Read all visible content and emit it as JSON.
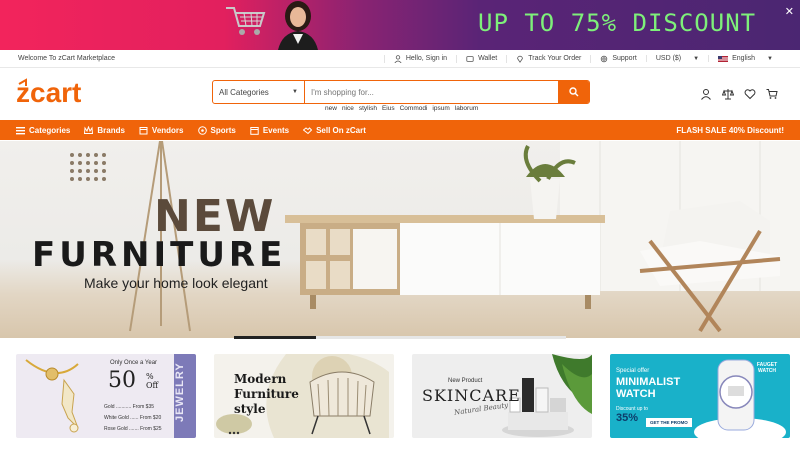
{
  "promo": {
    "text": "UP TO 75% DISCOUNT",
    "close": "✕"
  },
  "topbar": {
    "welcome": "Welcome To zCart Marketplace",
    "signin": "Hello, Sign in",
    "wallet": "Wallet",
    "track": "Track Your Order",
    "support": "Support",
    "currency": "USD ($)",
    "language": "English"
  },
  "logo": {
    "text": "zcart"
  },
  "search": {
    "category": "All Categories",
    "placeholder": "I'm shopping for...",
    "tags": [
      "new",
      "nice",
      "stylish",
      "Eius",
      "Commodi",
      "ipsum",
      "laborum"
    ]
  },
  "nav": {
    "items": [
      {
        "label": "Categories",
        "icon": "menu-icon"
      },
      {
        "label": "Brands",
        "icon": "crown-icon"
      },
      {
        "label": "Vendors",
        "icon": "store-icon"
      },
      {
        "label": "Sports",
        "icon": "ball-icon"
      },
      {
        "label": "Events",
        "icon": "calendar-icon"
      },
      {
        "label": "Sell On zCart",
        "icon": "handshake-icon"
      }
    ],
    "flash": "FLASH SALE 40% Discount!"
  },
  "hero": {
    "title1": "NEW",
    "title2": "FURNITURE",
    "subtitle": "Make your home look elegant"
  },
  "cards": [
    {
      "line1": "Only Once a Year",
      "big": "50",
      "unit": "% Off",
      "vertical": "JEWELRY",
      "rows": [
        [
          "Gold",
          "From $35"
        ],
        [
          "White Gold",
          "From $20"
        ],
        [
          "Rose Gold",
          "From $25"
        ]
      ]
    },
    {
      "title": "Modern Furniture style"
    },
    {
      "small": "New Product",
      "big": "SKINCARE",
      "script": "Natural Beauty"
    },
    {
      "small": "Special offer",
      "big": "MINIMALIST WATCH",
      "disc": "Discount up to",
      "pct": "35%",
      "btn": "GET THE PROMO",
      "corner": "FAUGET WATCH"
    }
  ],
  "colors": {
    "accent": "#f0640a",
    "promo_text": "#7ef07a",
    "watch_bg": "#19b1c9"
  }
}
